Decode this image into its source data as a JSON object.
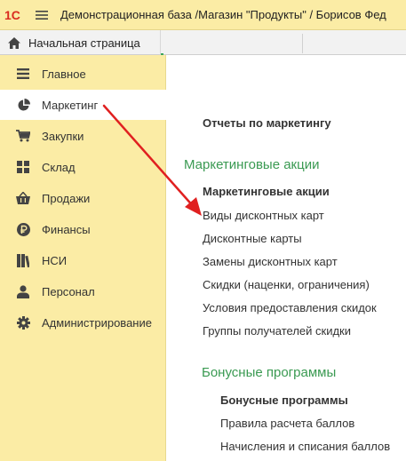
{
  "header": {
    "logo_text": "1С",
    "title": "Демонстрационная база /Магазин \"Продукты\" / Борисов Фед"
  },
  "tabs": {
    "home_label": "Начальная страница"
  },
  "sidebar": {
    "items": [
      {
        "label": "Главное",
        "icon": "list-icon"
      },
      {
        "label": "Маркетинг",
        "icon": "pie-chart-icon",
        "active": true
      },
      {
        "label": "Закупки",
        "icon": "cart-icon"
      },
      {
        "label": "Склад",
        "icon": "warehouse-icon"
      },
      {
        "label": "Продажи",
        "icon": "basket-icon"
      },
      {
        "label": "Финансы",
        "icon": "ruble-icon"
      },
      {
        "label": "НСИ",
        "icon": "reference-icon"
      },
      {
        "label": "Персонал",
        "icon": "person-icon"
      },
      {
        "label": "Администрирование",
        "icon": "gear-icon"
      }
    ]
  },
  "content": {
    "reports_link": "Отчеты по маркетингу",
    "promo_section": "Маркетинговые акции",
    "promo_links": [
      "Маркетинговые акции",
      "Виды дисконтных карт",
      "Дисконтные карты",
      "Замены дисконтных карт",
      "Скидки (наценки, ограничения)",
      "Условия предоставления скидок",
      "Группы получателей скидки"
    ],
    "bonus_section": "Бонусные программы",
    "bonus_links": [
      "Бонусные программы",
      "Правила расчета баллов",
      "Начисления и списания баллов"
    ]
  },
  "colors": {
    "sidebar_bg": "#fbeca5",
    "section_green": "#3a9a52",
    "arrow_red": "#e02020"
  }
}
